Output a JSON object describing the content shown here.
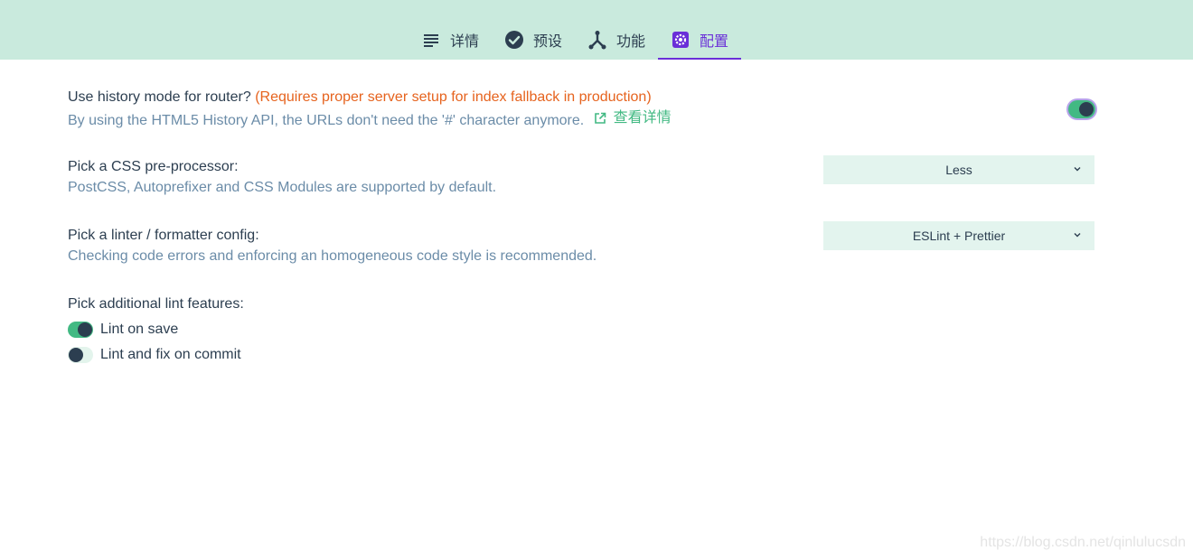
{
  "tabs": [
    {
      "label": "详情",
      "icon": "list-icon",
      "active": false
    },
    {
      "label": "预设",
      "icon": "check-circle-icon",
      "active": false
    },
    {
      "label": "功能",
      "icon": "fork-icon",
      "active": false
    },
    {
      "label": "配置",
      "icon": "gear-icon",
      "active": true
    }
  ],
  "router": {
    "title": "Use history mode for router?",
    "warning": "(Requires proper server setup for index fallback in production)",
    "description": "By using the HTML5 History API, the URLs don't need the '#' character anymore.",
    "link_label": "查看详情",
    "enabled": true
  },
  "css": {
    "title": "Pick a CSS pre-processor:",
    "description": "PostCSS, Autoprefixer and CSS Modules are supported by default.",
    "selected": "Less"
  },
  "linter": {
    "title": "Pick a linter / formatter config:",
    "description": "Checking code errors and enforcing an homogeneous code style is recommended.",
    "selected": "ESLint + Prettier"
  },
  "lint_features": {
    "title": "Pick additional lint features:",
    "options": [
      {
        "label": "Lint on save",
        "enabled": true
      },
      {
        "label": "Lint and fix on commit",
        "enabled": false
      }
    ]
  },
  "watermark": "https://blog.csdn.net/qinlulucsdn",
  "colors": {
    "header_bg": "#c9eadd",
    "accent": "#6a2fd8",
    "green": "#42b983",
    "warning": "#e6631e",
    "text": "#2c3e50",
    "muted": "#6b8ca8"
  }
}
